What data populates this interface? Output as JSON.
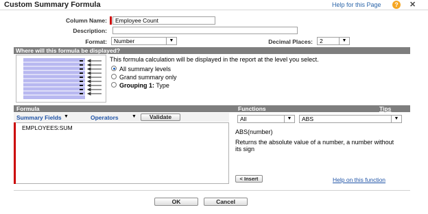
{
  "window": {
    "title": "Custom Summary Formula",
    "help_label": "Help for this Page"
  },
  "form": {
    "column_name_label": "Column Name:",
    "column_name_value": "Employee Count",
    "description_label": "Description:",
    "description_value": "",
    "format_label": "Format:",
    "format_value": "Number",
    "decimal_label": "Decimal Places:",
    "decimal_value": "2"
  },
  "display_section": {
    "header": "Where will this formula be displayed?",
    "intro": "This formula calculation will be displayed in the report at the level you select.",
    "options": [
      {
        "label": "All summary levels",
        "selected": true
      },
      {
        "label": "Grand summary only",
        "selected": false
      },
      {
        "label_bold": "Grouping 1:",
        "label_rest": " Type",
        "selected": false
      }
    ]
  },
  "formula_section": {
    "formula_header": "Formula",
    "functions_header": "Functions",
    "tips_label": "Tips",
    "summary_fields_label": "Summary Fields",
    "operators_label": "Operators",
    "validate_label": "Validate",
    "editor_text": "EMPLOYEES:SUM",
    "category_value": "All",
    "function_value": "ABS",
    "function_signature": "ABS(number)",
    "function_desc": "Returns the absolute value of a number, a number without its sign",
    "insert_label": "< Insert",
    "help_function_label": "Help on this function"
  },
  "footer": {
    "ok_label": "OK",
    "cancel_label": "Cancel"
  },
  "colors": {
    "band": "#7e7e7e",
    "required": "#cc0000",
    "link": "#1f53a6",
    "help_icon": "#f5a623"
  }
}
